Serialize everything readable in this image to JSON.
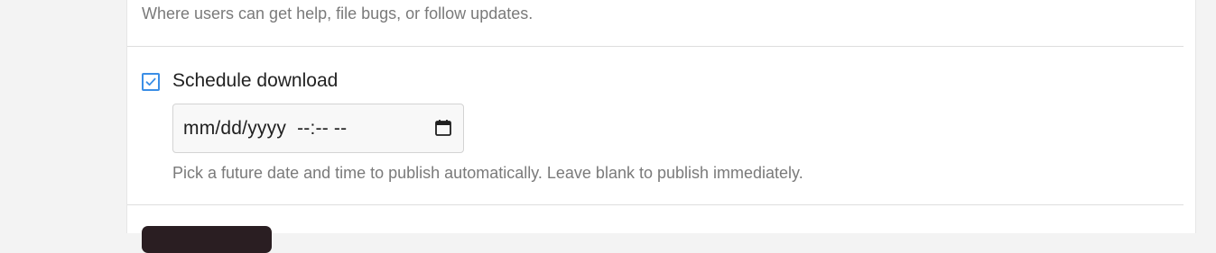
{
  "repository": {
    "help_text": "Where users can get help, file bugs, or follow updates."
  },
  "schedule": {
    "checkbox_label": "Schedule download",
    "checked": true,
    "datetime_placeholder": "mm/dd/yyyy  --:-- --",
    "help_text": "Pick a future date and time to publish automatically. Leave blank to publish immediately."
  },
  "icons": {
    "checkbox": "check-icon",
    "picker": "calendar-icon"
  },
  "colors": {
    "accent": "#3a8ee6",
    "button": "#2a1e22"
  }
}
